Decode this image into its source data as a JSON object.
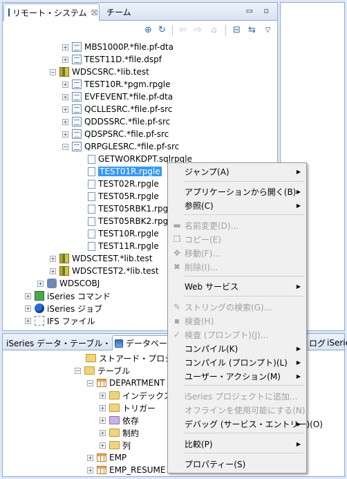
{
  "top_view": {
    "tabs": [
      {
        "label": "リモート・システム",
        "close": "☒"
      },
      {
        "label": "チーム"
      }
    ],
    "window_controls": "▭ ▫"
  },
  "tree": [
    {
      "label": "MBS1000P.*file.pf-dta"
    },
    {
      "label": "TEST11D.*file.dspf"
    },
    {
      "label": "WDSCSRC.*lib.test"
    },
    {
      "label": "TEST10R.*pgm.rpgle"
    },
    {
      "label": "EVFEVENT.*file.pf-dta"
    },
    {
      "label": "QCLLESRC.*file.pf-src"
    },
    {
      "label": "QDDSSRC.*file.pf-src"
    },
    {
      "label": "QDSPSRC.*file.pf-src"
    },
    {
      "label": "QRPGLESRC.*file.pf-src"
    },
    {
      "label": "GETWORKDPT.sqlrpgle"
    },
    {
      "label": "TEST01R.rpgle"
    },
    {
      "label": "TEST02R.rpgle"
    },
    {
      "label": "TEST05R.rpgle"
    },
    {
      "label": "TEST05RBK1.rpg"
    },
    {
      "label": "TEST05RBK2.rpg"
    },
    {
      "label": "TEST10R.rpgle"
    },
    {
      "label": "TEST11R.rpgle"
    },
    {
      "label": "WDSCTEST.*lib.test"
    },
    {
      "label": "WDSCTEST2.*lib.test"
    },
    {
      "label": "WDSCOBJ"
    },
    {
      "label": "iSeries コマンド"
    },
    {
      "label": "iSeries ジョブ"
    },
    {
      "label": "IFS ファイル"
    }
  ],
  "bottom_view": {
    "tabs": [
      {
        "label": "iSeries データ・テーブル・ビュー"
      },
      {
        "label": "データベース"
      },
      {
        "label": "ログ"
      },
      {
        "label": "iSerie"
      }
    ],
    "tree": [
      {
        "label": "ストアード・プロシージ"
      },
      {
        "label": "テーブル"
      },
      {
        "label": "DEPARTMENT"
      },
      {
        "label": "インデックス"
      },
      {
        "label": "トリガー"
      },
      {
        "label": "依存"
      },
      {
        "label": "制約"
      },
      {
        "label": "列"
      },
      {
        "label": "EMP"
      },
      {
        "label": "EMP_RESUME"
      }
    ]
  },
  "context_menu": {
    "items": [
      {
        "label": "ジャンプ(A)",
        "enabled": true,
        "submenu": true
      },
      {
        "label": "アプリケーションから開く(B)",
        "enabled": true,
        "submenu": true
      },
      {
        "label": "参照(C)",
        "enabled": true,
        "submenu": true
      },
      {
        "label": "名前変更(D)...",
        "enabled": false,
        "icon": "rename-icon"
      },
      {
        "label": "コピー(E)",
        "enabled": false,
        "icon": "copy-icon"
      },
      {
        "label": "移動(F)...",
        "enabled": false,
        "icon": "move-icon"
      },
      {
        "label": "削除(I)...",
        "enabled": false,
        "icon": "delete-icon"
      },
      {
        "label": "Web サービス",
        "enabled": true,
        "submenu": true
      },
      {
        "label": "ストリングの検索(G)...",
        "enabled": false,
        "icon": "search-string-icon"
      },
      {
        "label": "検査(H)",
        "enabled": false,
        "icon": "verify-icon"
      },
      {
        "label": "検査 (プロンプト)(J)...",
        "enabled": false,
        "icon": "verify-prompt-icon"
      },
      {
        "label": "コンパイル(K)",
        "enabled": true,
        "submenu": true
      },
      {
        "label": "コンパイル (プロンプト)(L)",
        "enabled": true,
        "submenu": true
      },
      {
        "label": "ユーザー・アクション(M)",
        "enabled": true,
        "submenu": true
      },
      {
        "label": "iSeries プロジェクトに追加...",
        "enabled": false
      },
      {
        "label": "オフラインを使用可能にする(N)",
        "enabled": false
      },
      {
        "label": "デバッグ (サービス・エントリー)(O)",
        "enabled": true,
        "submenu": true
      },
      {
        "label": "比較(P)",
        "enabled": true,
        "submenu": true
      },
      {
        "label": "プロパティー(S)",
        "enabled": true
      }
    ]
  },
  "colors": {
    "selection": "#3399ff",
    "view_border": "#8ea8cf",
    "menu_bg": "#f0f0f0"
  }
}
